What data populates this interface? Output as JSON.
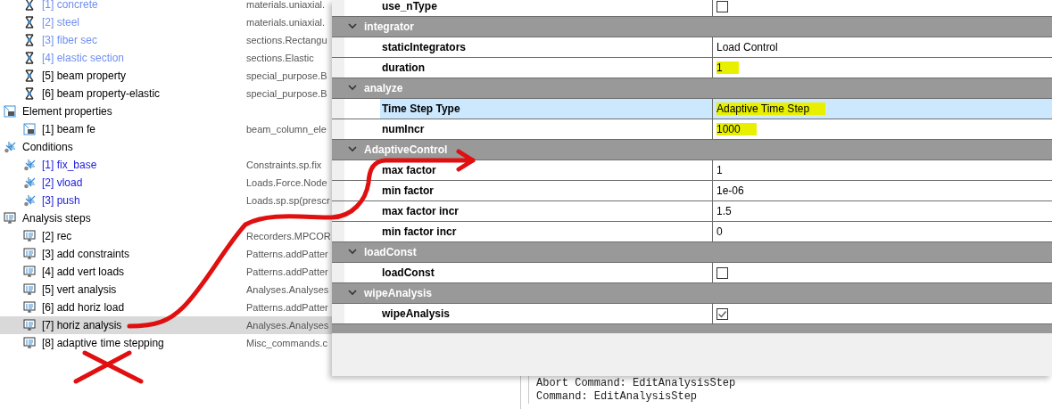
{
  "tree": [
    {
      "children": [
        {
          "label": "[1] concrete",
          "type_name": "materials.uniaxial.",
          "kind": "material",
          "color": "#6f8ff0",
          "selected": false
        },
        {
          "label": "[2] steel",
          "type_name": "materials.uniaxial.",
          "kind": "material",
          "color": "#6f8ff0",
          "selected": false
        },
        {
          "label": "[3] fiber sec",
          "type_name": "sections.Rectangu",
          "kind": "material",
          "color": "#6f8ff0",
          "selected": false
        },
        {
          "label": "[4] elastic section",
          "type_name": "sections.Elastic",
          "kind": "material",
          "color": "#6f8ff0",
          "selected": false
        },
        {
          "label": "[5] beam property",
          "type_name": "special_purpose.B",
          "kind": "material",
          "color": "#000000",
          "selected": false
        },
        {
          "label": "[6] beam property-elastic",
          "type_name": "special_purpose.B",
          "kind": "material",
          "color": "#000000",
          "selected": false
        }
      ]
    },
    {
      "label": "Element properties",
      "kind": "element",
      "color": "#000000",
      "selected": false,
      "children": [
        {
          "label": "[1] beam fe",
          "type_name": "beam_column_ele",
          "kind": "element",
          "color": "#000000",
          "selected": false
        }
      ]
    },
    {
      "label": "Conditions",
      "kind": "condition",
      "color": "#000000",
      "selected": false,
      "children": [
        {
          "label": "[1] fix_base",
          "type_name": "Constraints.sp.fix",
          "kind": "condition",
          "color": "#1a1ae0",
          "selected": false
        },
        {
          "label": "[2] vload",
          "type_name": "Loads.Force.Node",
          "kind": "condition",
          "color": "#1a1ae0",
          "selected": false
        },
        {
          "label": "[3] push",
          "type_name": "Loads.sp.sp(prescr",
          "kind": "condition",
          "color": "#1a1ae0",
          "selected": false
        }
      ]
    },
    {
      "label": "Analysis steps",
      "kind": "analysis",
      "color": "#000000",
      "selected": false,
      "children": [
        {
          "label": "[2] rec",
          "type_name": "Recorders.MPCOR",
          "kind": "analysis",
          "color": "#000000",
          "selected": false
        },
        {
          "label": "[3] add constraints",
          "type_name": "Patterns.addPatter",
          "kind": "analysis",
          "color": "#000000",
          "selected": false
        },
        {
          "label": "[4] add vert loads",
          "type_name": "Patterns.addPatter",
          "kind": "analysis",
          "color": "#000000",
          "selected": false
        },
        {
          "label": "[5] vert analysis",
          "type_name": "Analyses.Analyses",
          "kind": "analysis",
          "color": "#000000",
          "selected": false
        },
        {
          "label": "[6] add horiz load",
          "type_name": "Patterns.addPatter",
          "kind": "analysis",
          "color": "#000000",
          "selected": false
        },
        {
          "label": "[7] horiz analysis",
          "type_name": "Analyses.Analyses",
          "kind": "analysis",
          "color": "#000000",
          "selected": true
        },
        {
          "label": "[8] adaptive time stepping",
          "type_name": "Misc_commands.c",
          "kind": "analysis",
          "color": "#000000",
          "selected": false
        }
      ]
    }
  ],
  "property_grid": {
    "rows": [
      {
        "kind": "checkbox",
        "name": "use_nType",
        "checked": false,
        "selected": false
      },
      {
        "kind": "category",
        "name": "integrator",
        "expanded": true
      },
      {
        "kind": "text",
        "name": "staticIntegrators",
        "value": "Load Control",
        "selected": false,
        "highlighted": false
      },
      {
        "kind": "text",
        "name": "duration",
        "value": "1",
        "selected": false,
        "highlighted": true
      },
      {
        "kind": "category",
        "name": "analyze",
        "expanded": true
      },
      {
        "kind": "text",
        "name": "Time Step Type",
        "value": "Adaptive Time Step",
        "selected": true,
        "highlighted": true
      },
      {
        "kind": "text",
        "name": "numIncr",
        "value": "1000",
        "selected": false,
        "highlighted": true
      },
      {
        "kind": "category",
        "name": "AdaptiveControl",
        "expanded": true
      },
      {
        "kind": "text",
        "name": "max factor",
        "value": "1",
        "selected": false,
        "highlighted": false
      },
      {
        "kind": "text",
        "name": "min factor",
        "value": "1e-06",
        "selected": false,
        "highlighted": false
      },
      {
        "kind": "text",
        "name": "max factor incr",
        "value": "1.5",
        "selected": false,
        "highlighted": false
      },
      {
        "kind": "text",
        "name": "min factor incr",
        "value": "0",
        "selected": false,
        "highlighted": false
      },
      {
        "kind": "category",
        "name": "loadConst",
        "expanded": true
      },
      {
        "kind": "checkbox",
        "name": "loadConst",
        "checked": false,
        "selected": false
      },
      {
        "kind": "category",
        "name": "wipeAnalysis",
        "expanded": true
      },
      {
        "kind": "checkbox",
        "name": "wipeAnalysis",
        "checked": true,
        "selected": false
      }
    ]
  },
  "console": {
    "lines": [
      "Abort Command: EditAnalysisStep",
      "Command: EditAnalysisStep"
    ]
  },
  "annotations": {
    "arrow": true,
    "cross_mark": true
  }
}
